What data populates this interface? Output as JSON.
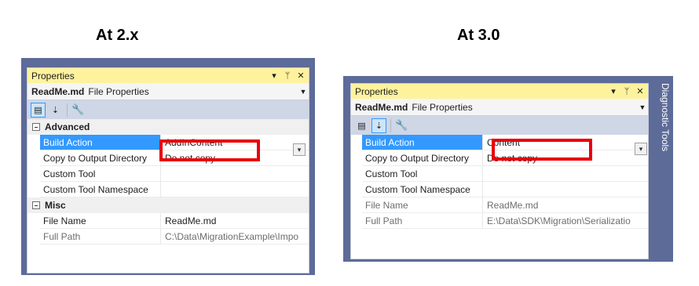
{
  "headings": {
    "left": "At 2.x",
    "right": "At 3.0"
  },
  "left_panel": {
    "title": "Properties",
    "object_name": "ReadMe.md",
    "object_type": "File Properties",
    "categories": [
      {
        "label": "Advanced",
        "rows": [
          {
            "name": "Build Action",
            "value": "AddInContent"
          },
          {
            "name": "Copy to Output Directory",
            "value": "Do not copy"
          },
          {
            "name": "Custom Tool",
            "value": ""
          },
          {
            "name": "Custom Tool Namespace",
            "value": ""
          }
        ]
      },
      {
        "label": "Misc",
        "rows": [
          {
            "name": "File Name",
            "value": "ReadMe.md"
          },
          {
            "name": "Full Path",
            "value": "C:\\Data\\MigrationExample\\Impo"
          }
        ]
      }
    ]
  },
  "right_panel": {
    "title": "Properties",
    "object_name": "ReadMe.md",
    "object_type": "File Properties",
    "rows": [
      {
        "name": "Build Action",
        "value": "Content"
      },
      {
        "name": "Copy to Output Directory",
        "value": "Do not copy"
      },
      {
        "name": "Custom Tool",
        "value": ""
      },
      {
        "name": "Custom Tool Namespace",
        "value": ""
      },
      {
        "name": "File Name",
        "value": "ReadMe.md"
      },
      {
        "name": "Full Path",
        "value": "E:\\Data\\SDK\\Migration\\Serializatio"
      }
    ],
    "side_tab": "Diagnostic Tools"
  },
  "icons": {
    "pin": "pin-icon",
    "dropdown": "dropdown-icon",
    "close": "close-icon",
    "categorized": "categorized-icon",
    "alphabetical": "alphabetical-icon",
    "property_pages": "wrench-icon"
  },
  "colors": {
    "title_bg": "#fff29d",
    "toolbar_bg": "#cfd6e5",
    "frame": "#5d6b99",
    "selection": "#3399ff",
    "highlight_box": "#e8000b"
  }
}
